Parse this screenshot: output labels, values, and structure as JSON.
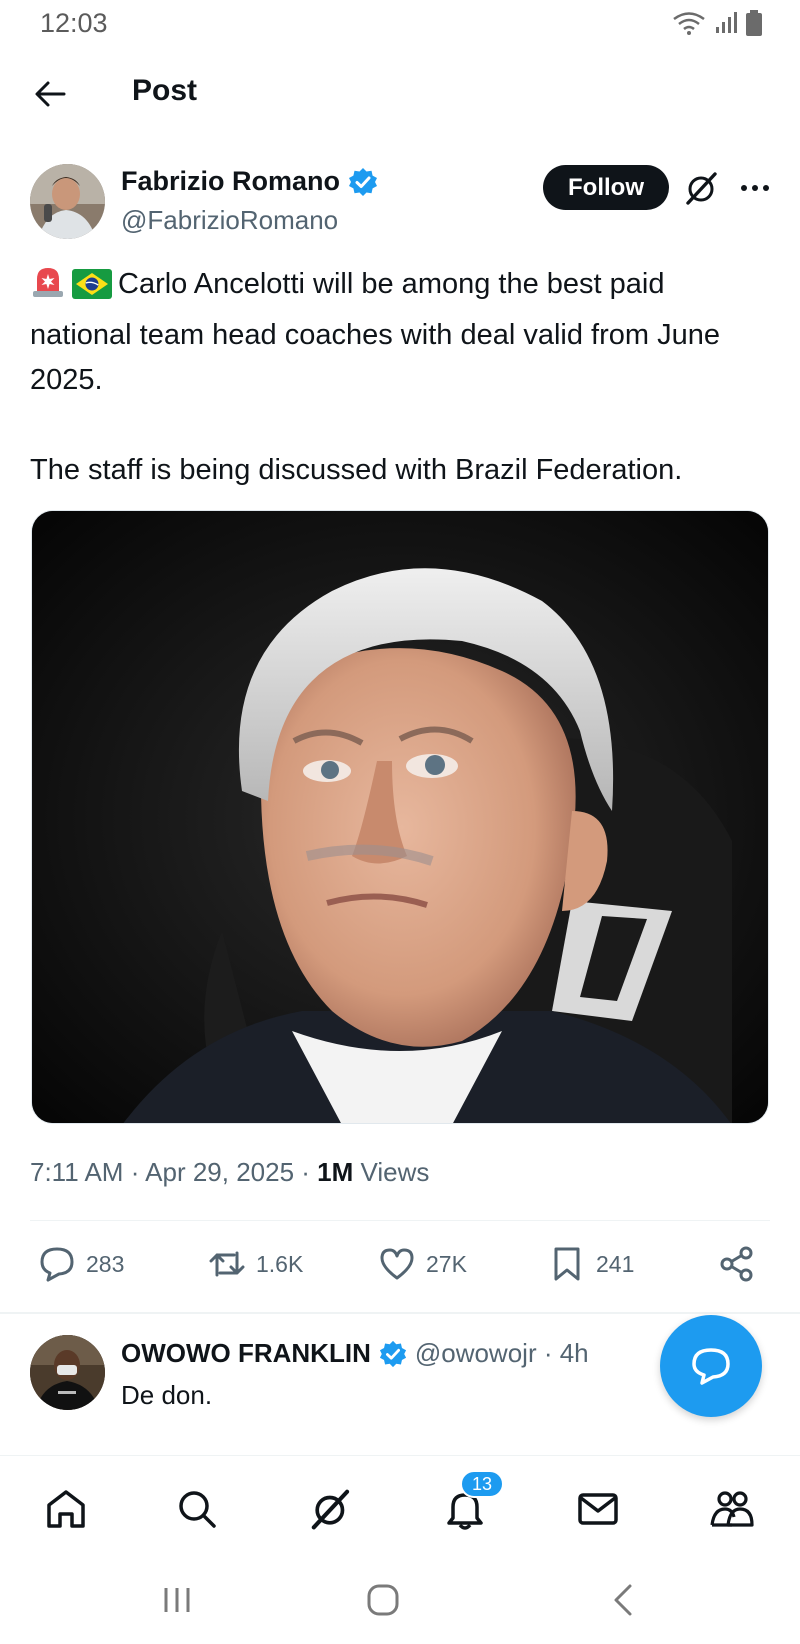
{
  "status_bar": {
    "time": "12:03"
  },
  "header": {
    "title": "Post"
  },
  "author": {
    "name": "Fabrizio Romano",
    "handle": "@FabrizioRomano",
    "follow_label": "Follow"
  },
  "tweet": {
    "line1": "Carlo Ancelotti will be among the best paid national team head coaches with deal valid from June 2025.",
    "line2": "The staff is being discussed with Brazil Federation.",
    "emoji1": "siren-emoji",
    "emoji2": "brazil-flag-emoji"
  },
  "meta": {
    "time": "7:11 AM",
    "date": "Apr 29, 2025",
    "views_count": "1M",
    "views_label": "Views"
  },
  "actions": {
    "replies": "283",
    "reposts": "1.6K",
    "likes": "27K",
    "bookmarks": "241"
  },
  "reply": {
    "name": "OWOWO FRANKLIN",
    "handle": "@owowojr · 4h",
    "text": "De don."
  },
  "bottom_nav": {
    "notifications_badge": "13",
    "items": [
      "home-icon",
      "search-icon",
      "grok-icon",
      "notifications-icon",
      "messages-icon",
      "communities-icon"
    ]
  },
  "colors": {
    "accent": "#1d9bf0",
    "text": "#0f1419",
    "secondary": "#536471"
  }
}
